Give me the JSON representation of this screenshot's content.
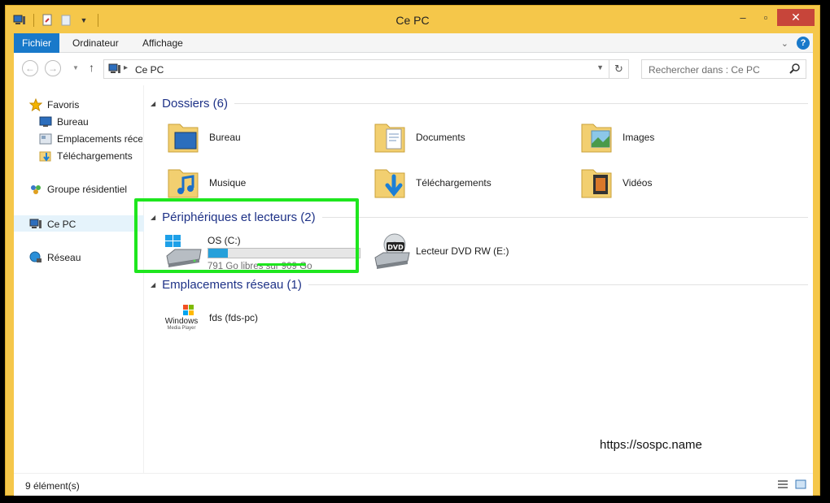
{
  "window": {
    "title": "Ce PC"
  },
  "ribbon": {
    "tabs": [
      "Fichier",
      "Ordinateur",
      "Affichage"
    ]
  },
  "address": {
    "crumb": "Ce PC",
    "search_placeholder": "Rechercher dans : Ce PC"
  },
  "nav": {
    "favoris": "Favoris",
    "bureau": "Bureau",
    "emplacements_recents": "Emplacements récents",
    "telechargements": "Téléchargements",
    "groupe": "Groupe résidentiel",
    "cepc": "Ce PC",
    "reseau": "Réseau"
  },
  "groups": {
    "dossiers": {
      "title": "Dossiers (6)"
    },
    "peripheriques": {
      "title": "Périphériques et lecteurs (2)"
    },
    "reseau": {
      "title": "Emplacements réseau (1)"
    }
  },
  "folders": [
    "Bureau",
    "Documents",
    "Images",
    "Musique",
    "Téléchargements",
    "Vidéos"
  ],
  "drives": {
    "c": {
      "name": "OS (C:)",
      "free_text": "791 Go libres sur 909 Go",
      "used_fraction": 0.13
    },
    "dvd": {
      "name": "Lecteur DVD RW (E:)",
      "badge": "DVD"
    }
  },
  "network": {
    "item": "fds (fds-pc)",
    "logo_line1": "Windows",
    "logo_line2": "Media Player"
  },
  "status": {
    "count": "9 élément(s)"
  },
  "watermark": "https://sospc.name",
  "colors": {
    "accent": "#1979ca",
    "title_bar": "#f5c74a",
    "group_header": "#1e3287",
    "highlight": "#1ee61e",
    "progress": "#26a0da"
  }
}
